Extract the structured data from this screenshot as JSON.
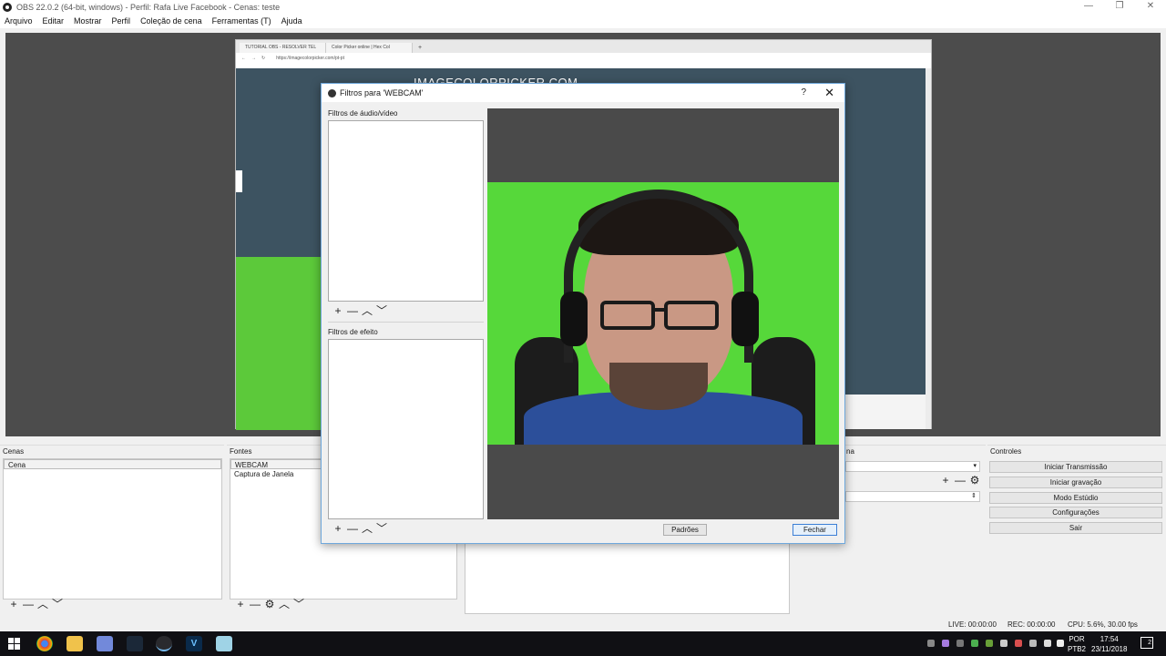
{
  "window": {
    "title": "OBS 22.0.2 (64-bit, windows) - Perfil: Rafa Live Facebook - Cenas: teste",
    "controls": [
      "—",
      "❐",
      "✕"
    ]
  },
  "menu": [
    "Arquivo",
    "Editar",
    "Mostrar",
    "Perfil",
    "Coleção de cena",
    "Ferramentas (T)",
    "Ajuda"
  ],
  "browser": {
    "tabs": [
      "TUTORIAL OBS - RESOLVER TEL",
      "Color Picker online | Hex Col"
    ],
    "new_tab": "+",
    "url": "https://imagecolorpicker.com/pt-pt",
    "site_title": "IMAGECOLORPICKER.COM"
  },
  "docks": {
    "scenes": {
      "title": "Cenas",
      "items": [
        "Cena"
      ]
    },
    "sources": {
      "title": "Fontes",
      "items": [
        "WEBCAM",
        "Captura de Janela"
      ]
    },
    "mixer": {
      "title": "na"
    },
    "controls": {
      "title": "Controles",
      "buttons": [
        "Iniciar Transmissão",
        "Iniciar gravação",
        "Modo Estúdio",
        "Configurações",
        "Sair"
      ]
    }
  },
  "toolbar_icons": {
    "add": "+",
    "remove": "—",
    "up": "︿",
    "down": "﹀",
    "gear": "⚙"
  },
  "status": {
    "live": "LIVE: 00:00:00",
    "rec": "REC: 00:00:00",
    "cpu": "CPU: 5.6%, 30.00 fps"
  },
  "dialog": {
    "title": "Filtros para 'WEBCAM'",
    "help": "?",
    "close": "✕",
    "audio_video_label": "Filtros de áudio/vídeo",
    "effect_label": "Filtros de efeito",
    "defaults_button": "Padrões",
    "close_button": "Fechar"
  },
  "taskbar": {
    "apps": [
      "chrome",
      "explorer",
      "discord",
      "steam",
      "obs",
      "vegas",
      "notepad"
    ],
    "lang": [
      "POR",
      "PTB2"
    ],
    "time": "17:54",
    "date": "23/11/2018",
    "notifications": "2"
  },
  "colors": {
    "preview_bg": "#4c4c4c",
    "chroma_green": "#56d83a",
    "site_bg": "#3d5361",
    "taskbar": "#101014",
    "accent": "#3c7fd6"
  }
}
